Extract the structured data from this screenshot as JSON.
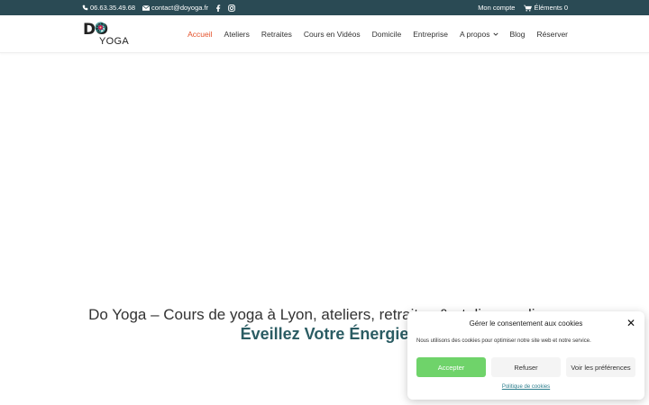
{
  "topbar": {
    "phone": "06.63.35.49.68",
    "email": "contact@doyoga.fr",
    "account": "Mon compte",
    "cart": "Éléments 0"
  },
  "logo": {
    "do": "DO",
    "yoga": "YOGA"
  },
  "nav": {
    "items": [
      {
        "label": "Accueil"
      },
      {
        "label": "Ateliers"
      },
      {
        "label": "Retraites"
      },
      {
        "label": "Cours en Vidéos"
      },
      {
        "label": "Domicile"
      },
      {
        "label": "Entreprise"
      },
      {
        "label": "A propos"
      },
      {
        "label": "Blog"
      },
      {
        "label": "Réserver"
      }
    ]
  },
  "hero": {
    "title": "Do Yoga – Cours de yoga à Lyon, ateliers, retraites & ateliers en ligne",
    "subtitle": "Éveillez Votre Énergie"
  },
  "cookie": {
    "title": "Gérer le consentement aux cookies",
    "message": "Nous utilisons des cookies pour optimiser notre site web et notre service.",
    "accept": "Accepter",
    "refuse": "Refuser",
    "preferences": "Voir les préférences",
    "policy": "Politique de cookies"
  },
  "colors": {
    "topbar_bg": "#2a4a54",
    "nav_active": "#e4512b",
    "subtitle": "#2b5c63",
    "accept": "#6fd36a"
  }
}
